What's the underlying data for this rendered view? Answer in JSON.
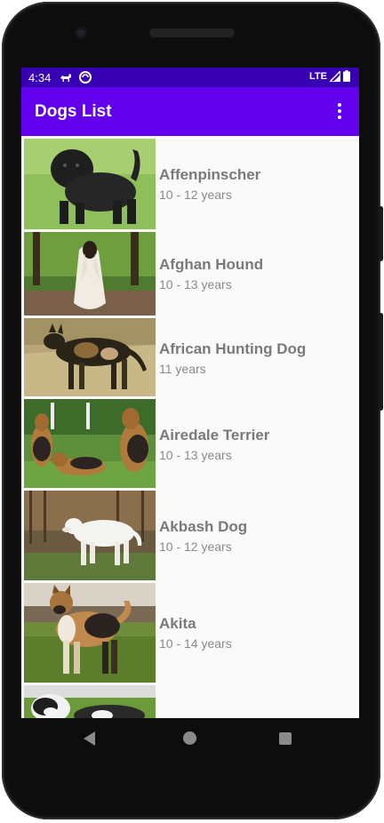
{
  "status_bar": {
    "time": "4:34",
    "network": "LTE"
  },
  "app_bar": {
    "title": "Dogs List"
  },
  "dogs": [
    {
      "name": "Affenpinscher",
      "life_span": "10 - 12 years"
    },
    {
      "name": "Afghan Hound",
      "life_span": "10 - 13 years"
    },
    {
      "name": "African Hunting Dog",
      "life_span": "11 years"
    },
    {
      "name": "Airedale Terrier",
      "life_span": "10 - 13 years"
    },
    {
      "name": "Akbash Dog",
      "life_span": "10 - 12 years"
    },
    {
      "name": "Akita",
      "life_span": "10 - 14 years"
    }
  ],
  "colors": {
    "status_bar": "#3700b3",
    "app_bar": "#6200ee",
    "background": "#fafafa"
  },
  "icons": [
    "dog-icon",
    "sync-icon",
    "signal-icon",
    "battery-icon",
    "overflow-menu-icon",
    "back-icon",
    "home-icon",
    "recents-icon"
  ]
}
